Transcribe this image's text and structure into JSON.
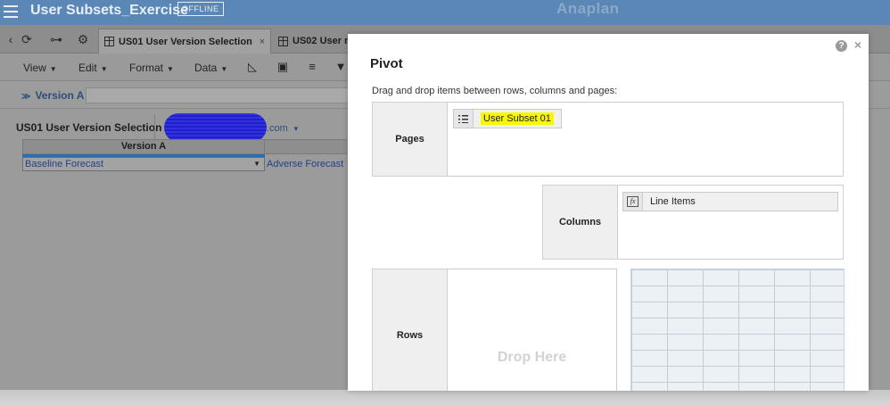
{
  "app": {
    "title": "User Subsets_Exercise",
    "status_badge": "OFFLINE",
    "brand": "Anaplan"
  },
  "tabs": [
    {
      "label": "US01 User Version Selection",
      "active": true,
      "closable": true
    },
    {
      "label": "US02 User n",
      "active": false
    }
  ],
  "toolbar": {
    "menus": [
      "View",
      "Edit",
      "Format",
      "Data"
    ]
  },
  "context": {
    "selector_label": "Version A"
  },
  "grid": {
    "title": "US01 User Version Selection",
    "user_suffix": ".com",
    "column_header": "Version A",
    "selected_value": "Baseline Forecast",
    "next_value": "Adverse Forecast"
  },
  "modal": {
    "title": "Pivot",
    "instructions": "Drag and drop items between rows, columns and pages:",
    "pages": {
      "label": "Pages",
      "items": [
        {
          "label": "User Subset 01",
          "icon": "list-icon"
        }
      ]
    },
    "columns": {
      "label": "Columns",
      "items": [
        {
          "label": "Line Items",
          "icon": "fx-icon"
        }
      ]
    },
    "rows": {
      "label": "Rows",
      "placeholder": "Drop Here"
    }
  },
  "colors": {
    "app_bar": "#5a87b5",
    "highlight": "#f7f700",
    "link": "#23418a"
  }
}
